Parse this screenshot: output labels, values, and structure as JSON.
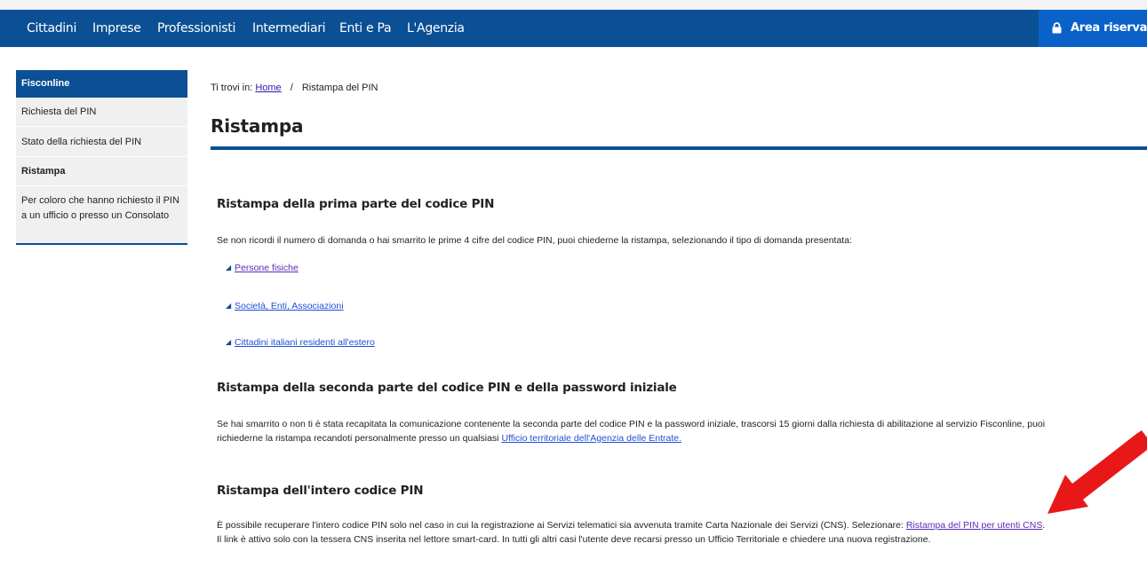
{
  "nav": {
    "items": [
      "Cittadini",
      "Imprese",
      "Professionisti",
      "Intermediari",
      "Enti e Pa",
      "L'Agenzia"
    ],
    "area_riservata": "Area riservata",
    "accent": "#0b4f94"
  },
  "sidebar": {
    "title": "Fisconline",
    "items": [
      {
        "label": "Richiesta del PIN"
      },
      {
        "label": "Stato della richiesta del PIN"
      },
      {
        "label": "Ristampa",
        "active": true
      },
      {
        "label": "Per coloro che hanno richiesto il PIN a un ufficio o presso un Consolato"
      }
    ]
  },
  "breadcrumb": {
    "prefix": "Ti trovi in:",
    "home": "Home",
    "separator": "/",
    "current": "Ristampa del PIN"
  },
  "page_title": "Ristampa",
  "sections": [
    {
      "heading": "Ristampa della prima parte del codice PIN",
      "text": "Se non ricordi il numero di domanda o hai smarrito le prime 4 cifre del codice PIN, puoi chiederne la ristampa, selezionando il tipo di domanda presentata:",
      "links": [
        "Persone fisiche",
        "Società, Enti, Associazioni",
        "Cittadini italiani residenti all'estero"
      ]
    },
    {
      "heading": "Ristampa della seconda parte del codice PIN e della password iniziale",
      "text_line1": "Se hai smarrito o non ti è stata recapitata la comunicazione contenente la seconda parte del codice PIN e la password iniziale, trascorsi 15 giorni dalla richiesta di abilitazione al servizio Fisconline, puoi",
      "text_line2_prefix": "richiederne la ristampa recandoti personalmente presso un qualsiasi",
      "text_line2_link": "Ufficio territoriale dell'Agenzia delle Entrate."
    },
    {
      "heading": "Ristampa dell'intero codice PIN",
      "text_line1_prefix": "È possibile recuperare l'intero codice PIN solo nel caso in cui la registrazione ai Servizi telematici sia avvenuta tramite Carta Nazionale dei Servizi (CNS). Selezionare:",
      "text_line1_link": "Ristampa del PIN per utenti CNS",
      "text_line1_suffix": ".",
      "text_line2": "Il link è attivo solo con la tessera CNS inserita nel lettore smart-card. In tutti gli altri casi l'utente deve recarsi presso un Ufficio Territoriale e chiedere una nuova registrazione."
    }
  ],
  "annotation": {
    "arrow_color": "#e81818",
    "icon": "red-arrow-icon"
  }
}
